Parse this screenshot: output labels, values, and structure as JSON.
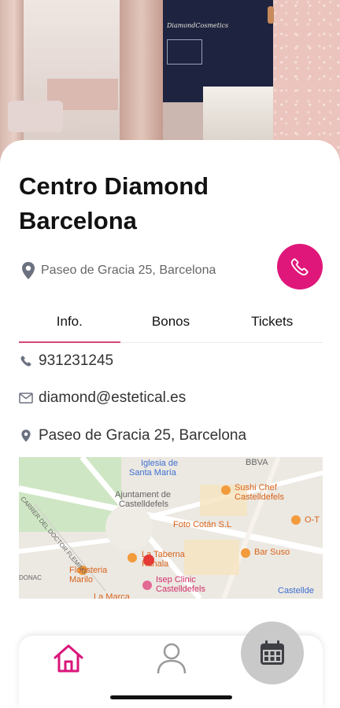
{
  "business": {
    "name": "Centro Diamond Barcelona",
    "address": "Paseo de Gracia 25, Barcelona",
    "hero_logo_text": "DiamondCosmetics"
  },
  "tabs": [
    {
      "label": "Info.",
      "active": true
    },
    {
      "label": "Bonos",
      "active": false
    },
    {
      "label": "Tickets",
      "active": false
    }
  ],
  "info": {
    "phone": "931231245",
    "email": "diamond@estetical.es",
    "address": "Paseo de Gracia 25, Barcelona"
  },
  "map": {
    "labels": {
      "iglesia": "Iglesia de",
      "iglesia2": "Santa María",
      "bbva": "BBVA",
      "sushi": "Sushi Chef",
      "sushi2": "Castelldefels",
      "ajuntament": "Ajuntament de",
      "ajuntament2": "Castelldefels",
      "foto": "Foto Cotán S.L",
      "ot": "O-T",
      "bar": "Bar Suso",
      "floristeria": "Floristeria",
      "floristeria2": "Marilo",
      "taberna": "La Taberna",
      "taberna2": "Kanala",
      "isep": "Isep Clinic",
      "isep2": "Castelldefels",
      "marca": "La Marca",
      "castelldefels": "Castellde",
      "street": "CARRER DEL DOCTOR FLEMING",
      "street2": "DONAC"
    }
  },
  "colors": {
    "accent": "#e0177a",
    "tab_underline": "#d4467a",
    "icon_gray": "#6b7180"
  },
  "icons": {
    "location": "map-pin-icon",
    "call": "phone-icon",
    "email": "envelope-icon",
    "home": "home-icon",
    "profile": "user-icon",
    "calendar": "calendar-icon"
  }
}
